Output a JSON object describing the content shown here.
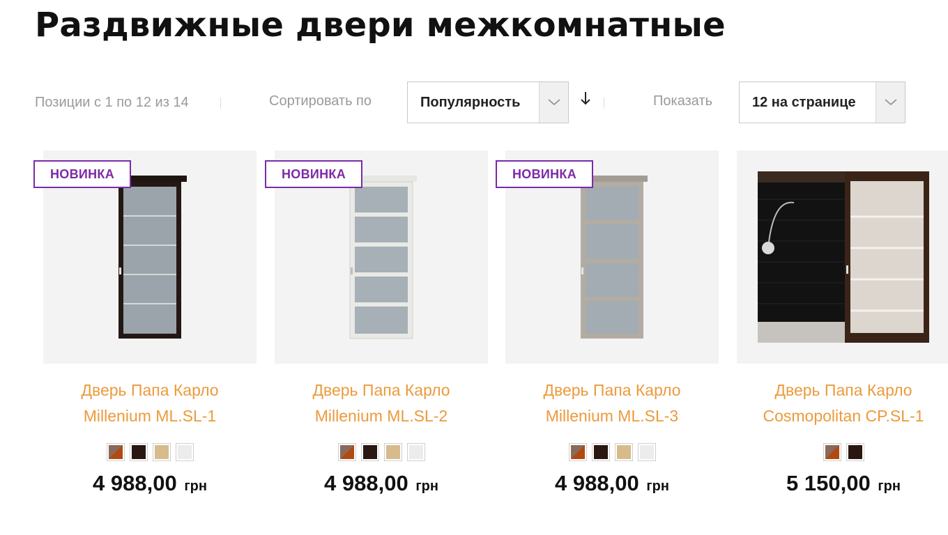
{
  "page": {
    "title": "Раздвижные двери межкомнатные"
  },
  "toolbar": {
    "amount": "Позиции с 1 по 12 из 14",
    "sort_label": "Сортировать по",
    "sort_value": "Популярность",
    "sort_dir_icon": "arrow-down-icon",
    "show_label": "Показать",
    "limit_value": "12 на странице",
    "chevron": "﹀"
  },
  "colors": {
    "accent_orange": "#ec9a3c",
    "badge_purple": "#7b2aa8",
    "swatch_walnut": "#8a4a2a",
    "swatch_wenge": "#2a1712",
    "swatch_oak": "#d7bb8c",
    "swatch_white": "#ececec"
  },
  "products": [
    {
      "badge": "НОВИНКА",
      "name_line1": "Дверь Папа Карло",
      "name_line2": "Millenium ML.SL-1",
      "price": "4 988,00",
      "currency": "грн",
      "swatches": [
        "walnut",
        "wenge",
        "oak",
        "white"
      ]
    },
    {
      "badge": "НОВИНКА",
      "name_line1": "Дверь Папа Карло",
      "name_line2": "Millenium ML.SL-2",
      "price": "4 988,00",
      "currency": "грн",
      "swatches": [
        "walnut",
        "wenge",
        "oak",
        "white"
      ]
    },
    {
      "badge": "НОВИНКА",
      "name_line1": "Дверь Папа Карло",
      "name_line2": "Millenium ML.SL-3",
      "price": "4 988,00",
      "currency": "грн",
      "swatches": [
        "walnut",
        "wenge",
        "oak",
        "white"
      ]
    },
    {
      "badge": "",
      "name_line1": "Дверь Папа Карло",
      "name_line2": "Cosmopolitan CP.SL-1",
      "price": "5 150,00",
      "currency": "грн",
      "swatches": [
        "walnut",
        "wenge"
      ]
    }
  ]
}
